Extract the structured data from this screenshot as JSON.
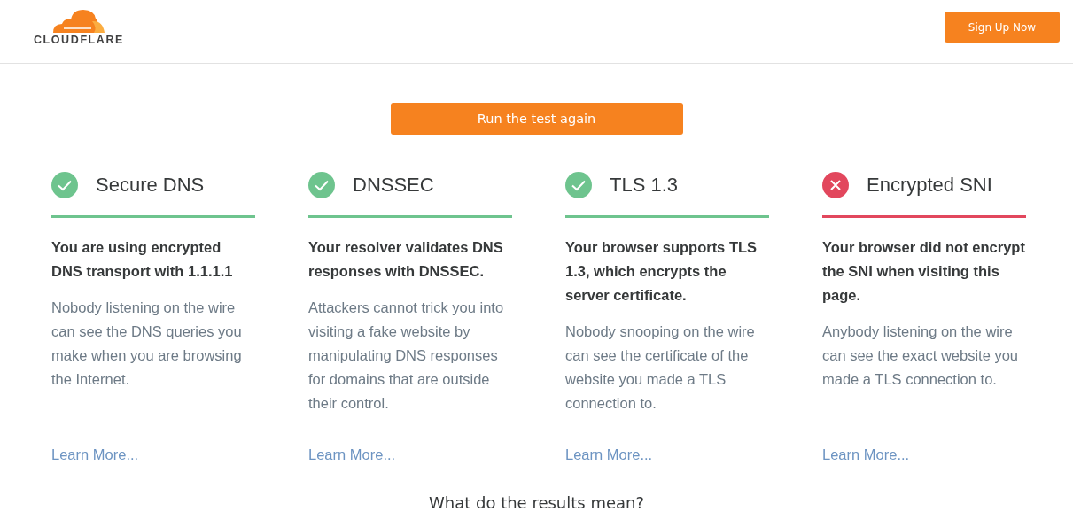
{
  "header": {
    "logo_text": "CLOUDFLARE",
    "signup_button": "Sign Up Now"
  },
  "run_button": "Run the test again",
  "checks": [
    {
      "title": "Secure DNS",
      "passed": true,
      "summary": "You are using encrypted DNS transport with 1.1.1.1",
      "description": "Nobody listening on the wire can see the DNS queries you make when you are browsing the Internet.",
      "link": "Learn More..."
    },
    {
      "title": "DNSSEC",
      "passed": true,
      "summary": "Your resolver validates DNS responses with DNSSEC.",
      "description": "Attackers cannot trick you into visiting a fake website by manipulating DNS responses for domains that are outside their control.",
      "link": "Learn More..."
    },
    {
      "title": "TLS 1.3",
      "passed": true,
      "summary": "Your browser supports TLS 1.3, which encrypts the server certificate.",
      "description": "Nobody snooping on the wire can see the certificate of the website you made a TLS connection to.",
      "link": "Learn More..."
    },
    {
      "title": "Encrypted SNI",
      "passed": false,
      "summary": "Your browser did not encrypt the SNI when visiting this page.",
      "description": "Anybody listening on the wire can see the exact website you made a TLS connection to.",
      "link": "Learn More..."
    }
  ],
  "results_heading": "What do the results mean?"
}
